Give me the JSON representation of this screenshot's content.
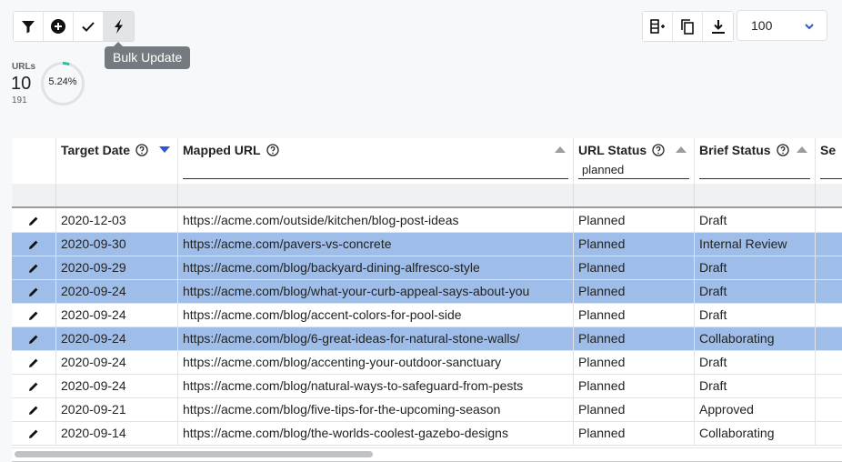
{
  "toolbar": {
    "left_buttons": [
      "filter-icon",
      "add-circle-icon",
      "check-icon",
      "bolt-icon"
    ],
    "right_buttons": [
      "add-column-icon",
      "copy-icon",
      "download-icon"
    ],
    "tooltip": "Bulk Update",
    "page_size": "100"
  },
  "stats": {
    "label": "URLs",
    "count": "10",
    "total": "191",
    "percent_text": "5.24%",
    "percent_value": 5.24
  },
  "columns": {
    "target_date": "Target Date",
    "mapped_url": "Mapped URL",
    "url_status": "URL Status",
    "url_status_filter": "planned",
    "brief_status": "Brief Status",
    "next_col": "Se"
  },
  "rows": [
    {
      "date": "2020-12-03",
      "url": "https://acme.com/outside/kitchen/blog-post-ideas",
      "url_status": "Planned",
      "brief_status": "Draft",
      "selected": false
    },
    {
      "date": "2020-09-30",
      "url": "https://acme.com/pavers-vs-concrete",
      "url_status": "Planned",
      "brief_status": "Internal Review",
      "selected": true
    },
    {
      "date": "2020-09-29",
      "url": "https://acme.com/blog/backyard-dining-alfresco-style",
      "url_status": "Planned",
      "brief_status": "Draft",
      "selected": true
    },
    {
      "date": "2020-09-24",
      "url": "https://acme.com/blog/what-your-curb-appeal-says-about-you",
      "url_status": "Planned",
      "brief_status": "Draft",
      "selected": true
    },
    {
      "date": "2020-09-24",
      "url": "https://acme.com/blog/accent-colors-for-pool-side",
      "url_status": "Planned",
      "brief_status": "Draft",
      "selected": false
    },
    {
      "date": "2020-09-24",
      "url": "https://acme.com/blog/6-great-ideas-for-natural-stone-walls/",
      "url_status": "Planned",
      "brief_status": "Collaborating",
      "selected": true
    },
    {
      "date": "2020-09-24",
      "url": "https://acme.com/blog/accenting-your-outdoor-sanctuary",
      "url_status": "Planned",
      "brief_status": "Draft",
      "selected": false
    },
    {
      "date": "2020-09-24",
      "url": "https://acme.com/blog/natural-ways-to-safeguard-from-pests",
      "url_status": "Planned",
      "brief_status": "Draft",
      "selected": false
    },
    {
      "date": "2020-09-21",
      "url": "https://acme.com/blog/five-tips-for-the-upcoming-season",
      "url_status": "Planned",
      "brief_status": "Approved",
      "selected": false
    },
    {
      "date": "2020-09-14",
      "url": "https://acme.com/blog/the-worlds-coolest-gazebo-designs",
      "url_status": "Planned",
      "brief_status": "Collaborating",
      "selected": false
    }
  ],
  "colors": {
    "selected_row": "#9fbde9",
    "gauge_accent": "#2bbfa4",
    "sort_active": "#2f55d4",
    "tooltip_bg": "#757a80"
  }
}
